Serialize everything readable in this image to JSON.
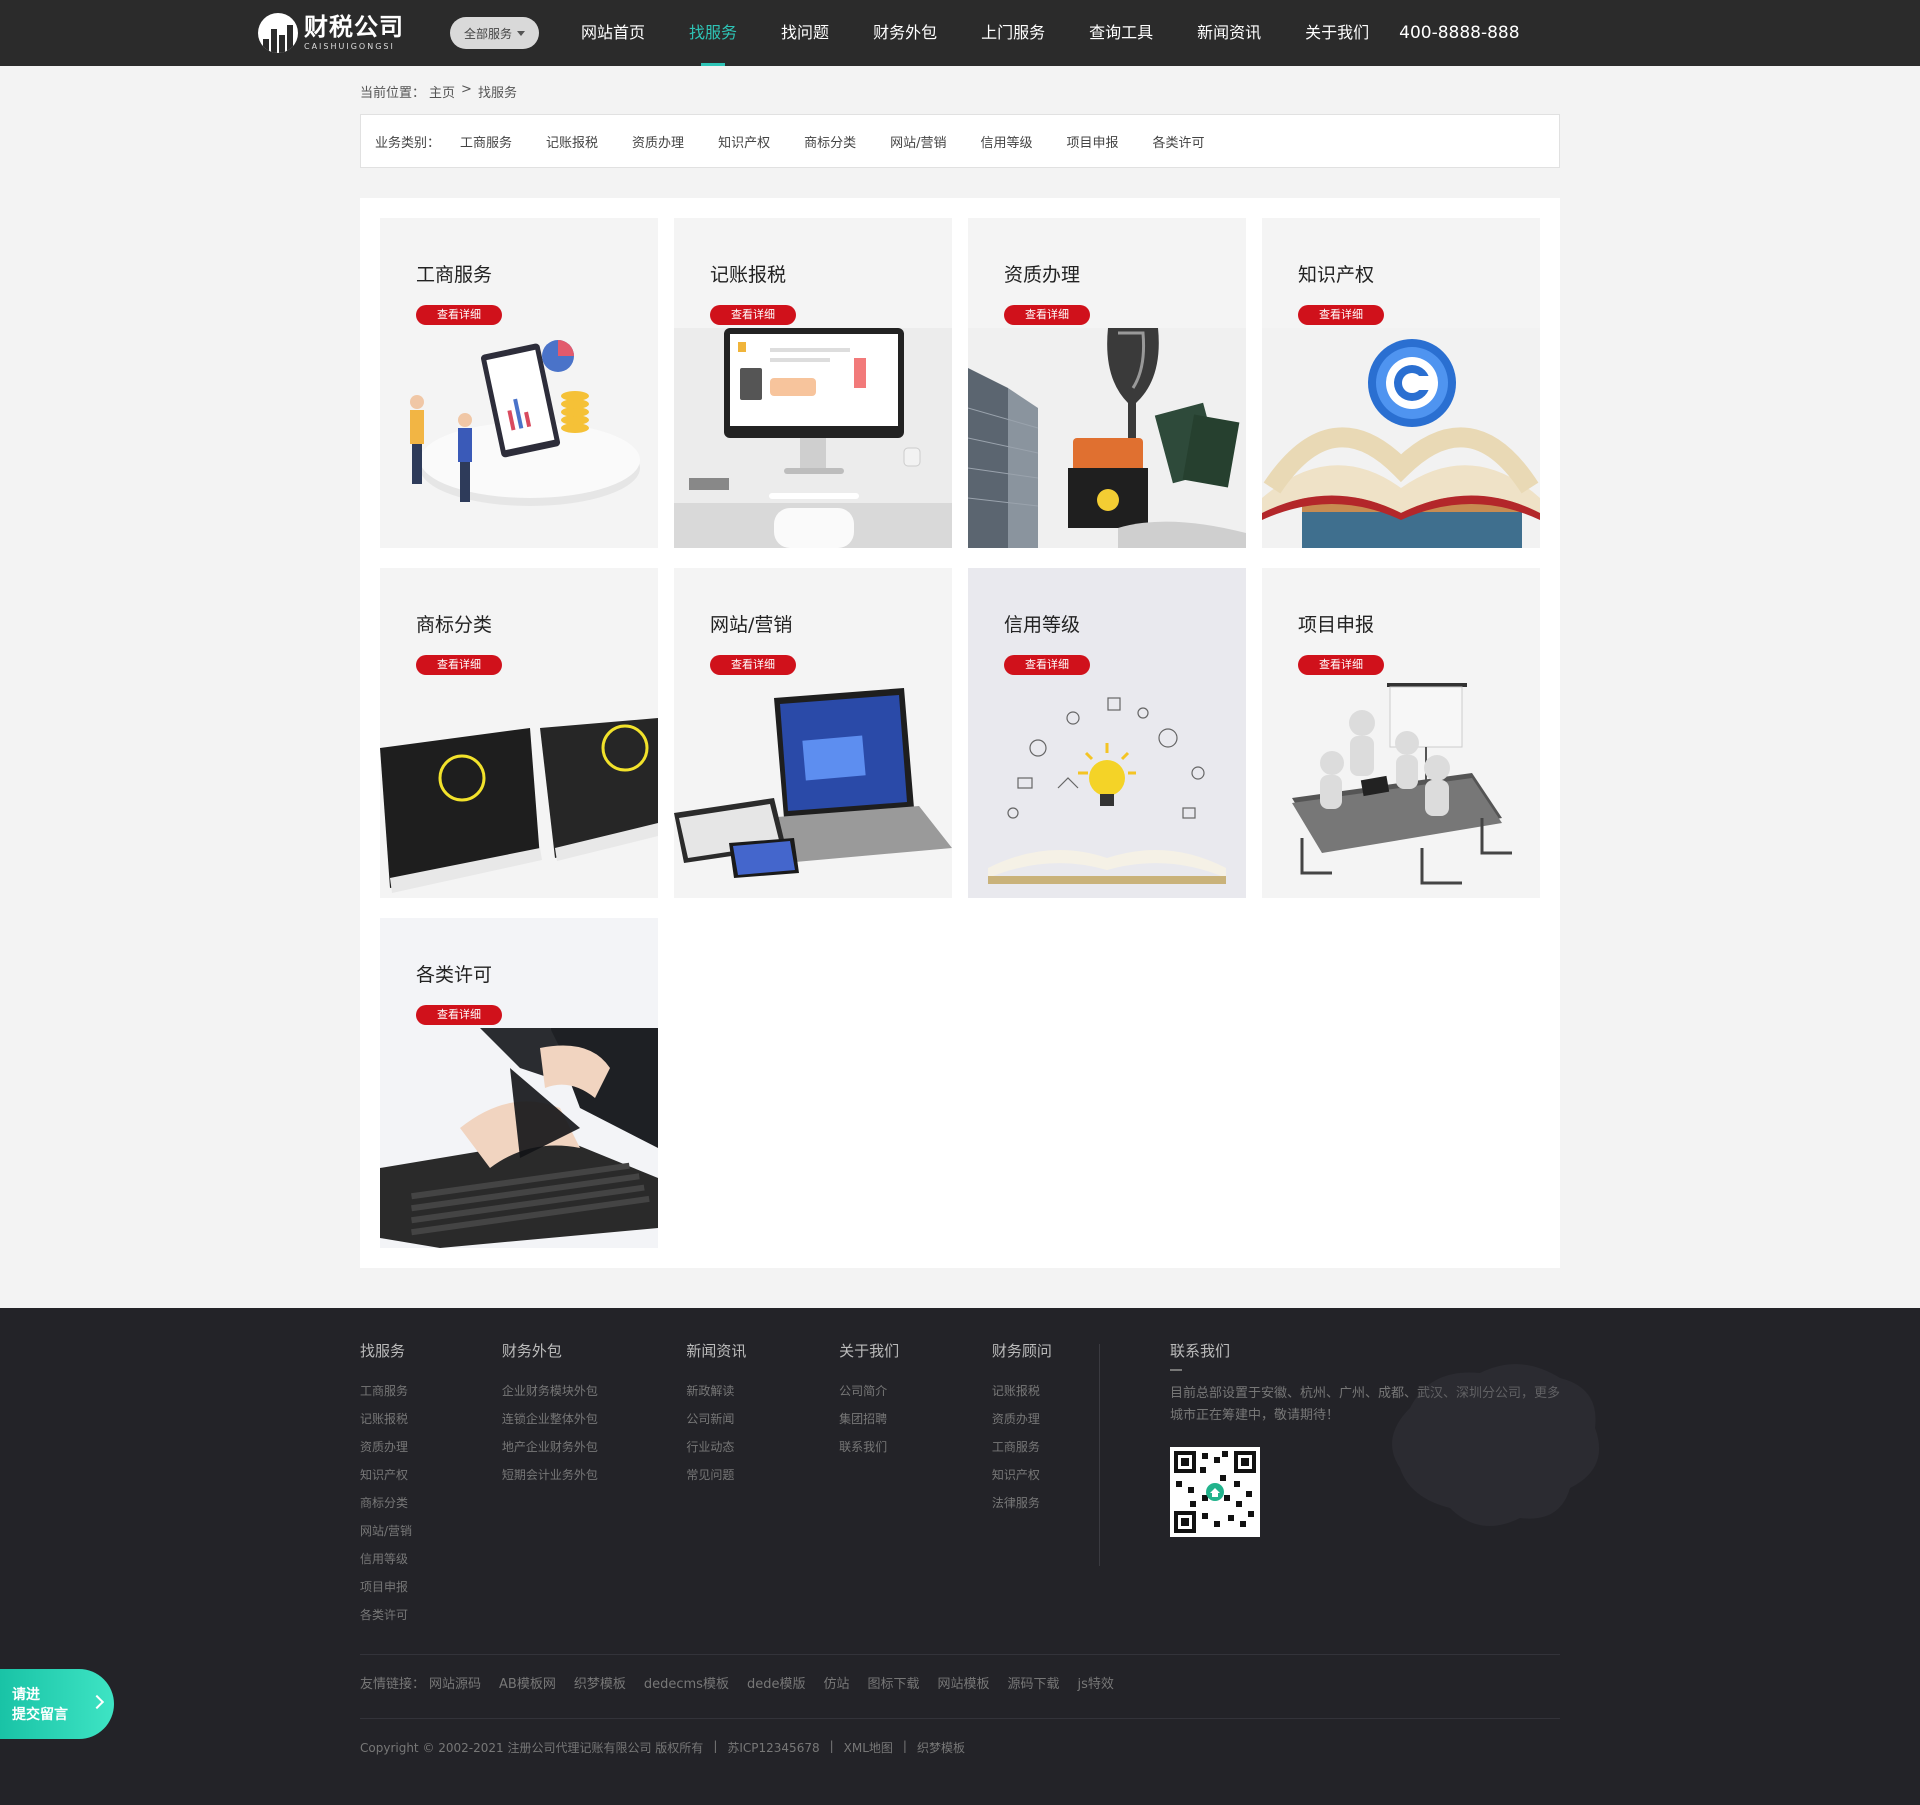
{
  "header": {
    "logo_cn": "财税公司",
    "logo_en": "CAISHUIGONGSI",
    "all_services": "全部服务",
    "nav": [
      "网站首页",
      "找服务",
      "找问题",
      "财务外包",
      "上门服务",
      "查询工具",
      "新闻资讯",
      "关于我们"
    ],
    "active_nav": "找服务",
    "phone": "400-8888-888"
  },
  "breadcrumb": {
    "prefix": "当前位置：",
    "home": "主页",
    "sep": ">",
    "current": "找服务"
  },
  "filter": {
    "label": "业务类别：",
    "items": [
      "工商服务",
      "记账报税",
      "资质办理",
      "知识产权",
      "商标分类",
      "网站/营销",
      "信用等级",
      "项目申报",
      "各类许可"
    ]
  },
  "cards": [
    {
      "title": "工商服务",
      "button": "查看详细"
    },
    {
      "title": "记账报税",
      "button": "查看详细"
    },
    {
      "title": "资质办理",
      "button": "查看详细"
    },
    {
      "title": "知识产权",
      "button": "查看详细"
    },
    {
      "title": "商标分类",
      "button": "查看详细"
    },
    {
      "title": "网站/营销",
      "button": "查看详细"
    },
    {
      "title": "信用等级",
      "button": "查看详细"
    },
    {
      "title": "项目申报",
      "button": "查看详细"
    },
    {
      "title": "各类许可",
      "button": "查看详细"
    }
  ],
  "footer": {
    "cols": [
      {
        "title": "找服务",
        "items": [
          "工商服务",
          "记账报税",
          "资质办理",
          "知识产权",
          "商标分类",
          "网站/营销",
          "信用等级",
          "项目申报",
          "各类许可"
        ]
      },
      {
        "title": "财务外包",
        "items": [
          "企业财务模块外包",
          "连锁企业整体外包",
          "地产企业财务外包",
          "短期会计业务外包"
        ]
      },
      {
        "title": "新闻资讯",
        "items": [
          "新政解读",
          "公司新闻",
          "行业动态",
          "常见问题"
        ]
      },
      {
        "title": "关于我们",
        "items": [
          "公司简介",
          "集团招聘",
          "联系我们"
        ]
      },
      {
        "title": "财务顾问",
        "items": [
          "记账报税",
          "资质办理",
          "工商服务",
          "知识产权",
          "法律服务"
        ]
      }
    ],
    "contact": {
      "title": "联系我们",
      "text": "目前总部设置于安徽、杭州、广州、成都、武汉、深圳分公司，更多城市正在筹建中，敬请期待！"
    },
    "friend_links_label": "友情链接：",
    "friend_links": [
      "网站源码",
      "AB模板网",
      "织梦模板",
      "dedecms模板",
      "dede模版",
      "仿站",
      "图标下载",
      "网站模板",
      "源码下载",
      "js特效"
    ],
    "copyright": [
      "Copyright © 2002-2021 注册公司代理记账有限公司 版权所有",
      "|",
      "苏ICP12345678",
      "|",
      "XML地图",
      "|",
      "织梦模板"
    ]
  },
  "float_button": {
    "line1": "请进",
    "line2": "提交留言"
  },
  "colors": {
    "accent": "#2ec4b6",
    "button_red": "#d0111b",
    "topbar": "#2b2b2b",
    "footer": "#232328"
  }
}
